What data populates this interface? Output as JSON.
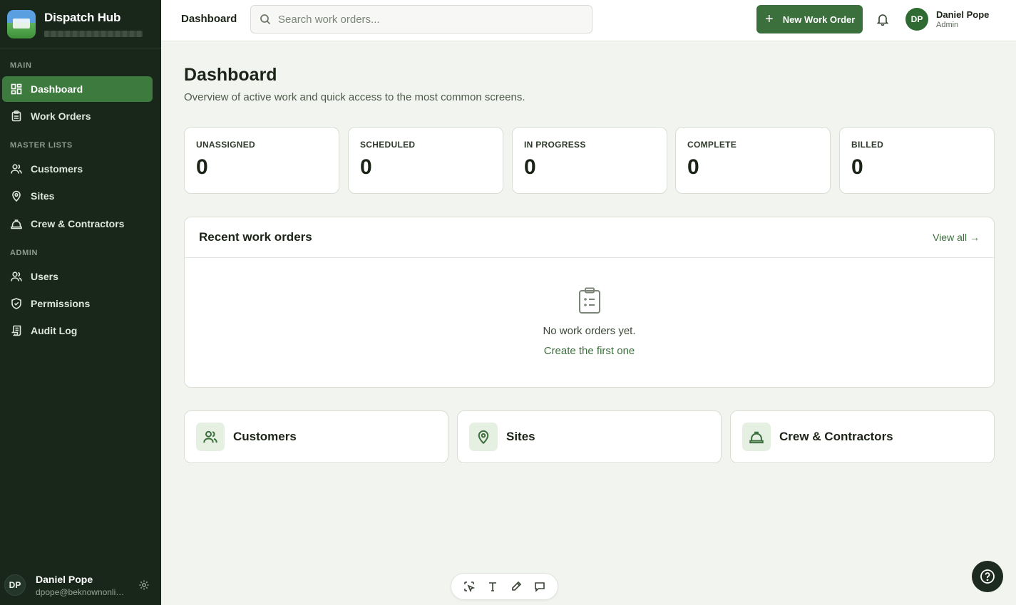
{
  "app": {
    "name": "Dispatch Hub"
  },
  "sidebar": {
    "sections": [
      {
        "label": "MAIN"
      },
      {
        "label": "MASTER LISTS"
      },
      {
        "label": "ADMIN"
      }
    ],
    "items": [
      {
        "label": "Dashboard",
        "icon": "dashboard-icon",
        "active": true
      },
      {
        "label": "Work Orders",
        "icon": "clipboard-icon"
      },
      {
        "label": "Customers",
        "icon": "users-icon"
      },
      {
        "label": "Sites",
        "icon": "map-pin-icon"
      },
      {
        "label": "Crew & Contractors",
        "icon": "hard-hat-icon"
      },
      {
        "label": "Users",
        "icon": "users-icon"
      },
      {
        "label": "Permissions",
        "icon": "shield-icon"
      },
      {
        "label": "Audit Log",
        "icon": "log-icon"
      }
    ],
    "user": {
      "initials": "DP",
      "name": "Daniel Pope",
      "email": "dpope@beknownonline.com"
    }
  },
  "header": {
    "title": "Dashboard",
    "search_placeholder": "Search work orders...",
    "new_button": "New Work Order",
    "user": {
      "initials": "DP",
      "name": "Daniel Pope",
      "role": "Admin"
    }
  },
  "page": {
    "title": "Dashboard",
    "subtitle": "Overview of active work and quick access to the most common screens."
  },
  "stats": [
    {
      "label": "UNASSIGNED",
      "value": "0"
    },
    {
      "label": "SCHEDULED",
      "value": "0"
    },
    {
      "label": "IN PROGRESS",
      "value": "0"
    },
    {
      "label": "COMPLETE",
      "value": "0"
    },
    {
      "label": "BILLED",
      "value": "0"
    }
  ],
  "recent": {
    "title": "Recent work orders",
    "view_all": "View all →",
    "empty_text": "No work orders yet.",
    "empty_link": "Create the first one"
  },
  "quick_links": [
    {
      "label": "Customers",
      "icon": "users-icon"
    },
    {
      "label": "Sites",
      "icon": "map-pin-icon"
    },
    {
      "label": "Crew & Contractors",
      "icon": "hard-hat-icon"
    }
  ],
  "colors": {
    "sidebar_bg": "#19271b",
    "accent": "#3b6f3c",
    "page_bg": "#f1f4ef"
  }
}
